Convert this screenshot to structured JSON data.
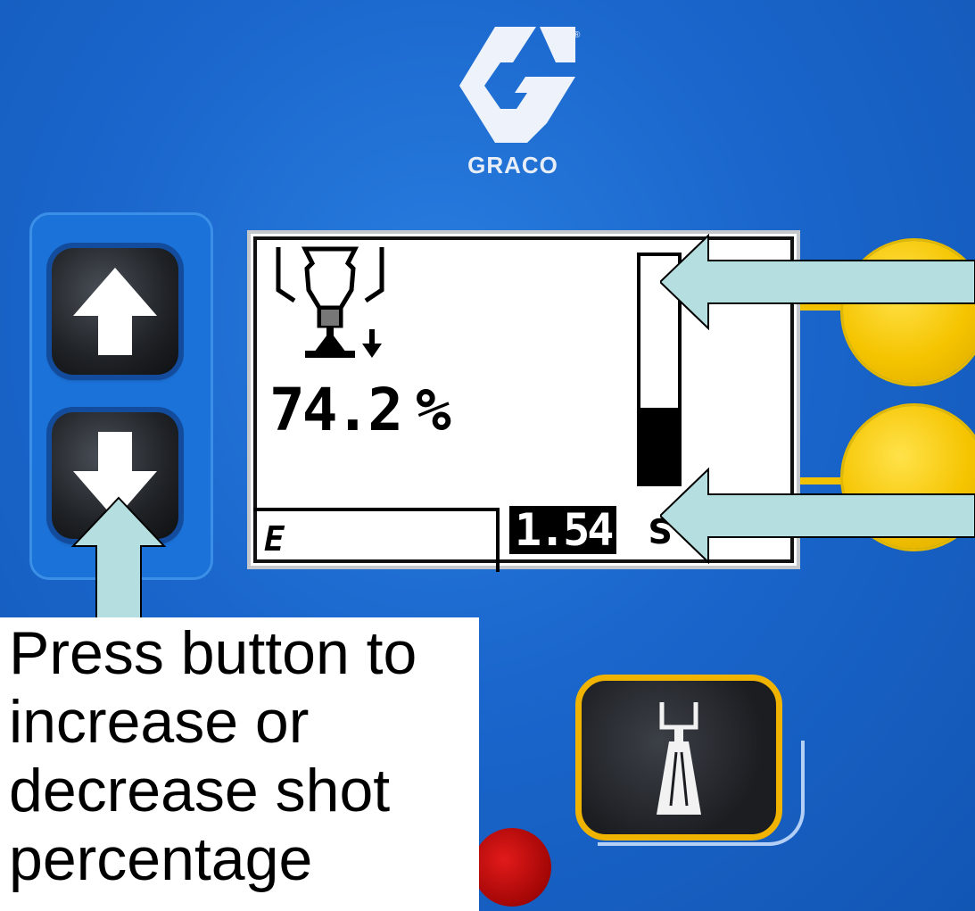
{
  "brand": {
    "name": "GRACO",
    "registered_mark": "®",
    "color": "#ffffff"
  },
  "panel": {
    "background": "#1a66cc"
  },
  "keys": {
    "up": {
      "icon": "arrow-up-icon"
    },
    "down": {
      "icon": "arrow-down-icon"
    }
  },
  "lcd": {
    "shot_icon": "spray-gun-down-icon",
    "shot_value": "74.2",
    "shot_unit": "%",
    "gauge_level": 0.33,
    "bottom_icon": "E",
    "time_value": "1.54",
    "time_unit": "s"
  },
  "side_buttons": {
    "color": "#f5c400"
  },
  "spray_button": {
    "icon": "spray-gun-icon",
    "border_color": "#f0b400"
  },
  "led": {
    "color": "#c40c0c"
  },
  "callout": {
    "text": "Press button to increase or decrease shot percentage",
    "arrow_color": "#b4dedf"
  }
}
